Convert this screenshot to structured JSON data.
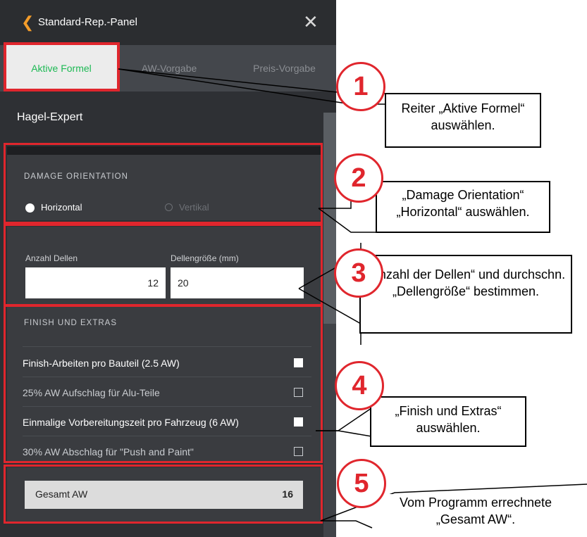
{
  "header": {
    "back_icon": "chevron-left-icon",
    "title": "Standard-Rep.-Panel",
    "close_icon": "close-icon"
  },
  "tabs": [
    {
      "label": "Aktive Formel",
      "active": true
    },
    {
      "label": "AW-Vorgabe",
      "active": false
    },
    {
      "label": "Preis-Vorgabe",
      "active": false
    }
  ],
  "section_title": "Hagel-Expert",
  "damage_orientation": {
    "caption": "DAMAGE ORIENTATION",
    "options": [
      {
        "label": "Horizontal",
        "selected": true
      },
      {
        "label": "Vertikal",
        "selected": false
      }
    ]
  },
  "dents": {
    "count_label": "Anzahl Dellen",
    "count_value": "12",
    "size_label": "Dellengröße (mm)",
    "size_value": "20"
  },
  "finish": {
    "caption": "FINISH UND EXTRAS",
    "items": [
      {
        "label": "Finish-Arbeiten pro Bauteil (2.5 AW)",
        "checked": true
      },
      {
        "label": "25% AW Aufschlag für Alu-Teile",
        "checked": false
      },
      {
        "label": "Einmalige Vorbereitungszeit pro Fahrzeug (6 AW)",
        "checked": true
      },
      {
        "label": "30% AW Abschlag für \"Push and Paint\"",
        "checked": false
      }
    ]
  },
  "total": {
    "label": "Gesamt AW",
    "value": "16"
  },
  "annotations": [
    {
      "number": "1",
      "text": "Reiter „Aktive Formel“ auswählen."
    },
    {
      "number": "2",
      "text": "„Damage Orientation“ „Horizontal“ auswählen."
    },
    {
      "number": "3",
      "text": "„Anzahl der Dellen“ und durchschn. „Dellengröße“ bestimmen."
    },
    {
      "number": "4",
      "text": "„Finish und Extras“ auswählen."
    },
    {
      "number": "5",
      "text": "Vom Programm errechnete „Gesamt AW“."
    }
  ],
  "colors": {
    "accent_orange": "#f39c2a",
    "active_tab_green": "#1db954",
    "annotation_red": "#e0262d",
    "panel_bg": "#2e3034"
  }
}
